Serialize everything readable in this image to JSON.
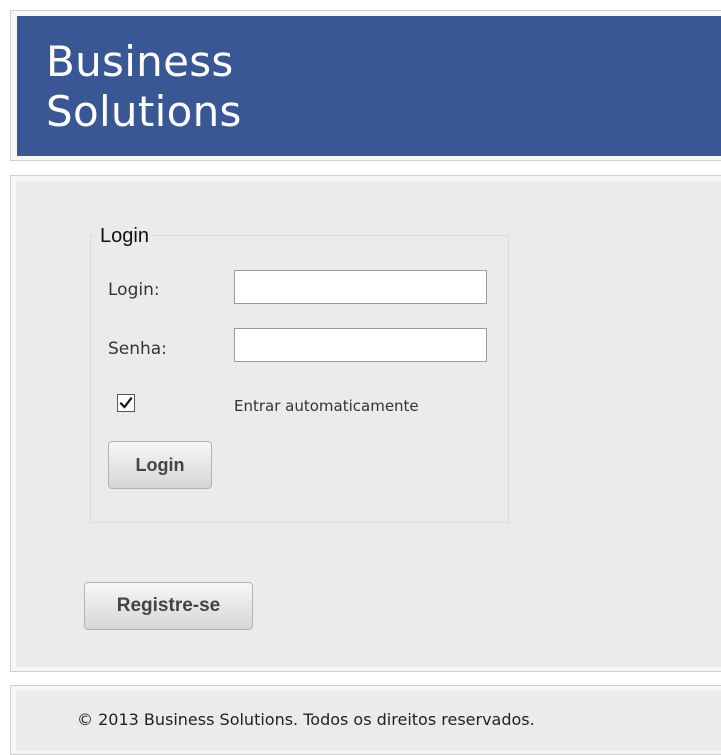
{
  "header": {
    "brand_line1": "Business",
    "brand_line2": "Solutions",
    "banner_color": "#3a5795"
  },
  "login_form": {
    "legend": "Login",
    "login_label": "Login:",
    "login_value": "",
    "password_label": "Senha:",
    "password_value": "",
    "remember_label": "Entrar automaticamente",
    "remember_checked": true,
    "submit_label": "Login"
  },
  "register": {
    "label": "Registre-se"
  },
  "footer": {
    "copyright": "© 2013 Business Solutions. Todos os direitos reservados."
  }
}
